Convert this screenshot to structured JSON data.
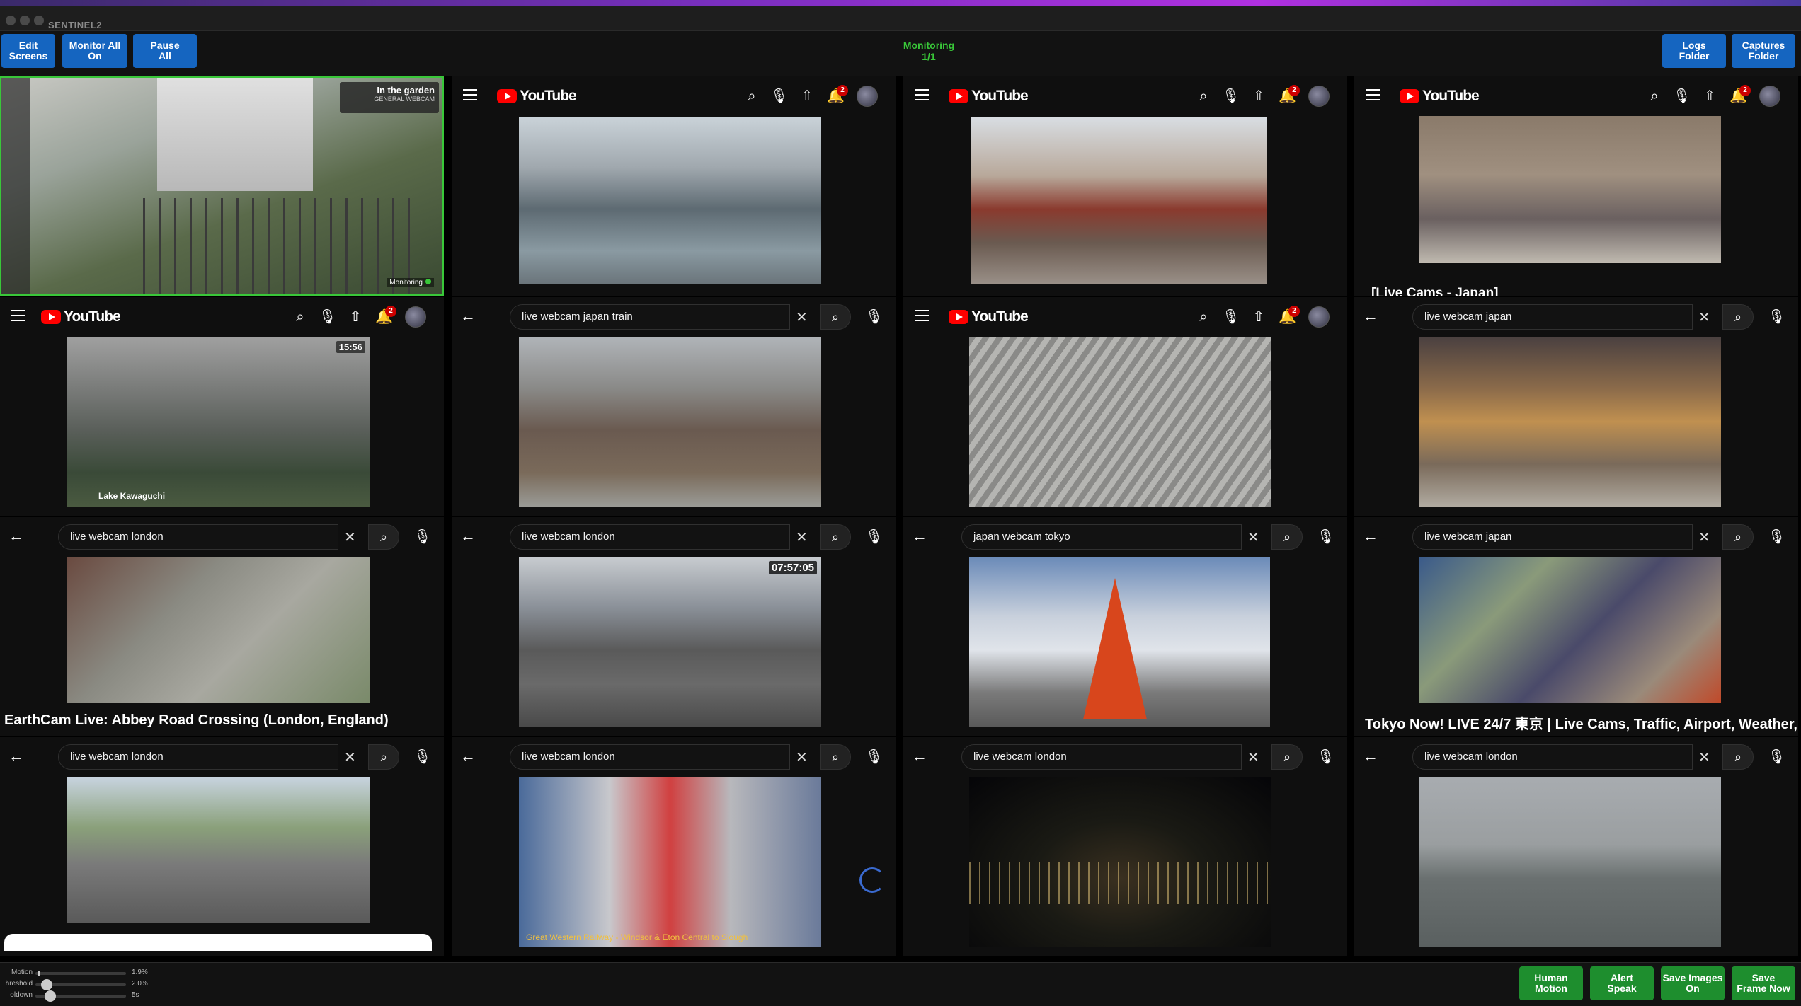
{
  "app": {
    "title": "SENTINEL2"
  },
  "toolbar": {
    "edit_screens": "Edit\nScreens",
    "monitor_all_on": "Monitor All\nOn",
    "pause_all": "Pause\nAll",
    "monitoring_status": "Monitoring\n1/1",
    "logs_folder": "Logs\nFolder",
    "captures_folder": "Captures\nFolder"
  },
  "cells": {
    "c11": {
      "overlay_title": "In the garden",
      "overlay_sub": "GENERAL WEBCAM",
      "monitoring": "Monitoring"
    },
    "c12": {
      "logo": "YouTube",
      "badge": "2"
    },
    "c13": {
      "logo": "YouTube",
      "badge": "2"
    },
    "c14": {
      "logo": "YouTube",
      "badge": "2",
      "partial_title": "[Live Cams - Japan]"
    },
    "c21": {
      "logo": "YouTube",
      "badge": "2",
      "timestamp": "15:56",
      "caption": "Lake Kawaguchi"
    },
    "c22": {
      "search": "live webcam japan train"
    },
    "c23": {
      "logo": "YouTube",
      "badge": "2"
    },
    "c24": {
      "search": "live webcam japan"
    },
    "c31": {
      "search": "live webcam london",
      "video_title": "EarthCam Live: Abbey Road Crossing (London, England)"
    },
    "c32": {
      "search": "live webcam london",
      "timestamp": "07:57:05"
    },
    "c33": {
      "search": "japan webcam tokyo"
    },
    "c34": {
      "search": "live webcam japan",
      "video_title": "Tokyo Now! LIVE 24/7 東京 | Live Cams, Traffic, Airport, Weather,"
    },
    "c41": {
      "search": "live webcam london"
    },
    "c42": {
      "search": "live webcam london",
      "caption": "Great Western Railway - Windsor & Eton Central to Slough"
    },
    "c43": {
      "search": "live webcam london"
    },
    "c44": {
      "search": "live webcam london"
    }
  },
  "sliders": {
    "motion": {
      "label": "Motion",
      "value": "1.9%",
      "level": 0.02
    },
    "threshold": {
      "label": "hreshold",
      "value": "2.0%",
      "level": 0.06
    },
    "cooldown": {
      "label": "oldown",
      "value": "5s",
      "level": 0.1
    }
  },
  "bottom_buttons": {
    "human_motion": "Human\nMotion",
    "alert_speak": "Alert\nSpeak",
    "save_images_on": "Save Images\nOn",
    "save_frame_now": "Save\nFrame Now"
  },
  "colors": {
    "accent_blue": "#1565c0",
    "status_green": "#39c739",
    "button_green": "#1e8e2e",
    "youtube_red": "#ff0000"
  }
}
